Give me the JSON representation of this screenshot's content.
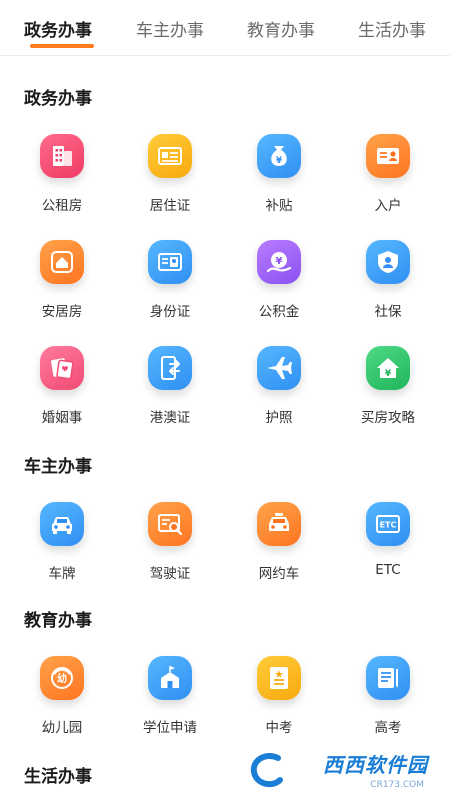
{
  "tabs": [
    {
      "label": "政务办事",
      "active": true
    },
    {
      "label": "车主办事",
      "active": false
    },
    {
      "label": "教育办事",
      "active": false
    },
    {
      "label": "生活办事",
      "active": false
    }
  ],
  "colors": {
    "accent": "#ff7a1a",
    "red": "#ef3b64",
    "yellow": "#f8a90e",
    "blue": "#2f8ff2",
    "orange": "#ff7420",
    "purple": "#8b51f0",
    "green": "#1fb55b"
  },
  "sections": {
    "gov": {
      "title": "政务办事",
      "items": [
        {
          "label": "公租房",
          "icon": "building-icon",
          "color": "red"
        },
        {
          "label": "居住证",
          "icon": "id-card-icon",
          "color": "yellow"
        },
        {
          "label": "补贴",
          "icon": "money-bag-icon",
          "color": "blue"
        },
        {
          "label": "入户",
          "icon": "household-card-icon",
          "color": "orange"
        },
        {
          "label": "安居房",
          "icon": "house-icon",
          "color": "orange"
        },
        {
          "label": "身份证",
          "icon": "identity-card-icon",
          "color": "blue"
        },
        {
          "label": "公积金",
          "icon": "fund-coin-icon",
          "color": "purple"
        },
        {
          "label": "社保",
          "icon": "shield-person-icon",
          "color": "blue"
        },
        {
          "label": "婚姻事",
          "icon": "marriage-certificate-icon",
          "color": "pink"
        },
        {
          "label": "港澳证",
          "icon": "travel-permit-icon",
          "color": "blue"
        },
        {
          "label": "护照",
          "icon": "airplane-icon",
          "color": "blue"
        },
        {
          "label": "买房攻略",
          "icon": "house-price-icon",
          "color": "green"
        }
      ]
    },
    "car": {
      "title": "车主办事",
      "items": [
        {
          "label": "车牌",
          "icon": "car-icon",
          "color": "blue"
        },
        {
          "label": "驾驶证",
          "icon": "license-search-icon",
          "color": "orange"
        },
        {
          "label": "网约车",
          "icon": "taxi-icon",
          "color": "orange"
        },
        {
          "label": "ETC",
          "icon": "etc-icon",
          "color": "blue"
        }
      ]
    },
    "edu": {
      "title": "教育办事",
      "items": [
        {
          "label": "幼儿园",
          "icon": "kindergarten-icon",
          "color": "orange"
        },
        {
          "label": "学位申请",
          "icon": "school-icon",
          "color": "blue"
        },
        {
          "label": "中考",
          "icon": "exam-book-icon",
          "color": "yellow"
        },
        {
          "label": "高考",
          "icon": "exam-paper-icon",
          "color": "blue"
        }
      ]
    },
    "life": {
      "title": "生活办事"
    }
  },
  "icon_glyphs": {
    "money": "¥",
    "kindergarten": "幼",
    "etc": "ETC"
  },
  "watermark": {
    "text": "西西软件园",
    "sub": "CR173.COM"
  }
}
